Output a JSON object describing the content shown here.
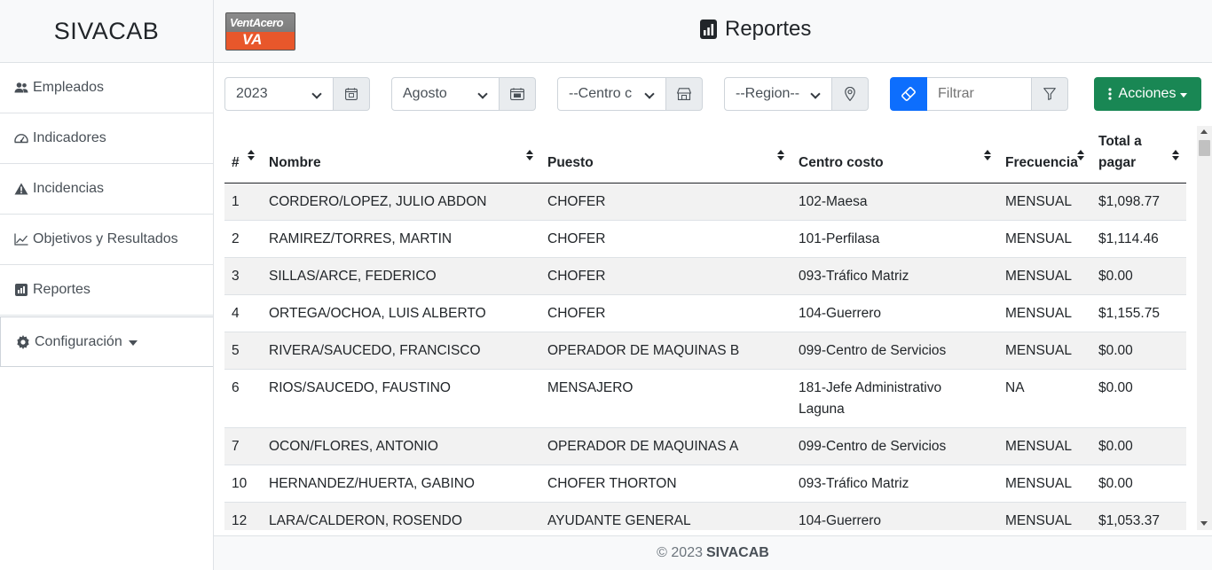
{
  "app": {
    "brand": "SIVACAB"
  },
  "logo": {
    "text": "VentAcero",
    "mark": "VA"
  },
  "header": {
    "title": "Reportes",
    "title_icon": "bar-chart-icon"
  },
  "sidebar": {
    "items": [
      {
        "label": "Empleados",
        "icon": "people-icon"
      },
      {
        "label": "Indicadores",
        "icon": "speedometer-icon"
      },
      {
        "label": "Incidencias",
        "icon": "warning-icon"
      },
      {
        "label": "Objetivos y Resultados",
        "icon": "line-chart-icon"
      },
      {
        "label": "Reportes",
        "icon": "bar-chart-icon"
      },
      {
        "label": "Configuración",
        "icon": "gear-icon"
      }
    ]
  },
  "filters": {
    "year": "2023",
    "month": "Agosto",
    "centro": "--Centro c",
    "region": "--Region--",
    "search_placeholder": "Filtrar",
    "actions_label": "Acciones",
    "colors": {
      "primary": "#0d6efd",
      "success": "#198754"
    }
  },
  "table": {
    "headers": [
      "#",
      "Nombre",
      "Puesto",
      "Centro costo",
      "Frecuencia",
      "Total a pagar"
    ],
    "rows": [
      [
        "1",
        "CORDERO/LOPEZ, JULIO ABDON",
        "CHOFER",
        "102-Maesa",
        "MENSUAL",
        "$1,098.77"
      ],
      [
        "2",
        "RAMIREZ/TORRES, MARTIN",
        "CHOFER",
        "101-Perfilasa",
        "MENSUAL",
        "$1,114.46"
      ],
      [
        "3",
        "SILLAS/ARCE, FEDERICO",
        "CHOFER",
        "093-Tráfico Matriz",
        "MENSUAL",
        "$0.00"
      ],
      [
        "4",
        "ORTEGA/OCHOA, LUIS ALBERTO",
        "CHOFER",
        "104-Guerrero",
        "MENSUAL",
        "$1,155.75"
      ],
      [
        "5",
        "RIVERA/SAUCEDO, FRANCISCO",
        "OPERADOR DE MAQUINAS B",
        "099-Centro de Servicios",
        "MENSUAL",
        "$0.00"
      ],
      [
        "6",
        "RIOS/SAUCEDO, FAUSTINO",
        "MENSAJERO",
        "181-Jefe Administrativo Laguna",
        "NA",
        "$0.00"
      ],
      [
        "7",
        "OCON/FLORES, ANTONIO",
        "OPERADOR DE MAQUINAS A",
        "099-Centro de Servicios",
        "MENSUAL",
        "$0.00"
      ],
      [
        "10",
        "HERNANDEZ/HUERTA, GABINO",
        "CHOFER THORTON",
        "093-Tráfico Matriz",
        "MENSUAL",
        "$0.00"
      ],
      [
        "12",
        "LARA/CALDERON, ROSENDO",
        "AYUDANTE GENERAL",
        "104-Guerrero",
        "MENSUAL",
        "$1,053.37"
      ]
    ]
  },
  "footer": {
    "copyright": "© 2023",
    "brand": "SIVACAB"
  }
}
